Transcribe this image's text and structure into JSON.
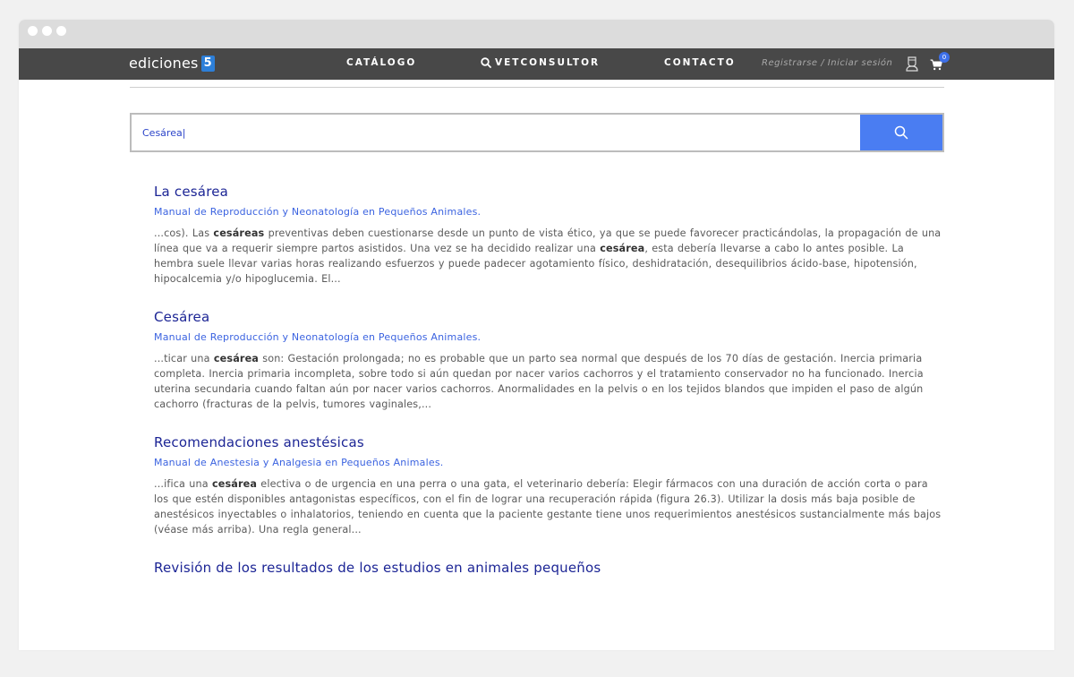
{
  "navbar": {
    "logo_text": "ediciones",
    "logo_mark": "5",
    "catalogo": "CATÁLOGO",
    "vetconsultor": "VETCONSULTOR",
    "contacto": "CONTACTO",
    "auth": "Registrarse / Iniciar sesión",
    "cart_count": "0"
  },
  "search": {
    "value": "Cesárea|"
  },
  "results": [
    {
      "title": "La cesárea",
      "source": "Manual de Reproducción y Neonatología en Pequeños Animales.",
      "snippet_parts": [
        "...cos). Las ",
        "cesáreas",
        " preventivas deben cuestionarse desde un punto de vista ético, ya que se puede favorecer practicándolas, la propagación de una línea que va a requerir siempre partos asistidos. Una vez se ha decidido realizar una ",
        "cesárea",
        ", esta debería llevarse a cabo lo antes posible. La hembra suele llevar varias horas realizando esfuerzos y puede padecer agotamiento físico, deshidratación, desequilibrios ácido-base, hipotensión, hipocalcemia y/o hipoglucemia. El..."
      ]
    },
    {
      "title": "Cesárea",
      "source": "Manual de Reproducción y Neonatología en Pequeños Animales.",
      "snippet_parts": [
        "...ticar una ",
        "cesárea",
        " son: Gestación prolongada; no es probable que un parto sea normal que después de los 70 días de gestación. Inercia primaria completa. Inercia primaria incompleta, sobre todo si aún quedan por nacer varios cachorros y el tratamiento conservador no ha funcionado. Inercia uterina secundaria cuando faltan aún por nacer varios cachorros. Anormalidades en la pelvis o en los tejidos blandos que impiden el paso de algún cachorro (fracturas de la pelvis, tumores vaginales,..."
      ]
    },
    {
      "title": "Recomendaciones anestésicas",
      "source": "Manual de Anestesia y Analgesia en Pequeños Animales.",
      "snippet_parts": [
        "...ifica una ",
        "cesárea",
        " electiva o de urgencia en una perra o una gata, el veterinario debería: Elegir fármacos con una duración de acción corta o para los que estén disponibles antagonistas específicos, con el fin de lograr una recuperación rápida (figura 26.3). Utilizar la dosis más baja posible de anestésicos inyectables o inhalatorios, teniendo en cuenta que la paciente gestante tiene unos requerimientos anestésicos sustancialmente más bajos (véase más arriba). Una regla general..."
      ]
    },
    {
      "title": "Revisión de los resultados de los estudios en animales pequeños",
      "source": "",
      "snippet_parts": []
    }
  ]
}
